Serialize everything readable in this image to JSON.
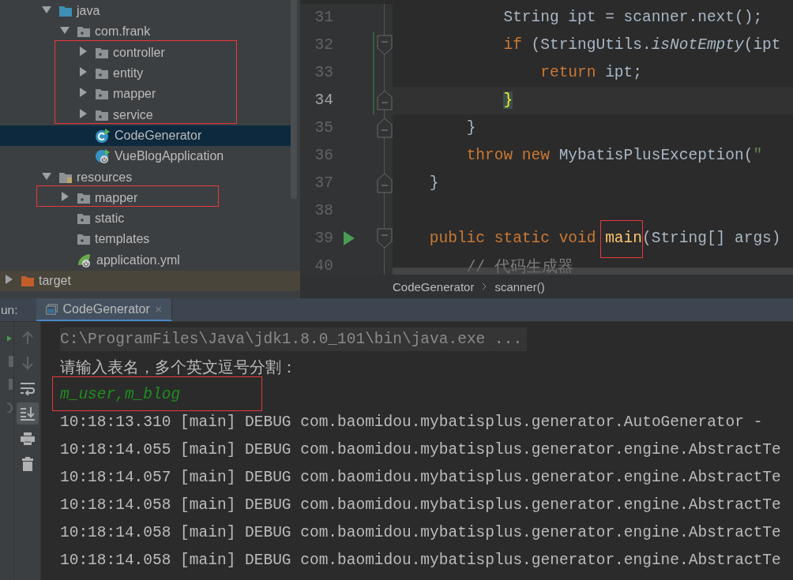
{
  "project_tree": {
    "items": [
      {
        "label": "java",
        "kind": "source-folder",
        "expanded": true,
        "selected": false,
        "boxed": false,
        "children": [
          {
            "label": "com.frank",
            "kind": "package",
            "expanded": true,
            "selected": false,
            "boxed": false,
            "children": [
              {
                "label": "controller",
                "kind": "package",
                "expanded": false,
                "selected": false,
                "boxed": true
              },
              {
                "label": "entity",
                "kind": "package",
                "expanded": false,
                "selected": false,
                "boxed": true
              },
              {
                "label": "mapper",
                "kind": "package",
                "expanded": false,
                "selected": false,
                "boxed": true
              },
              {
                "label": "service",
                "kind": "package",
                "expanded": false,
                "selected": false,
                "boxed": true
              },
              {
                "label": "CodeGenerator",
                "kind": "runnable-class",
                "selected": true,
                "boxed": false
              },
              {
                "label": "VueBlogApplication",
                "kind": "spring-app",
                "selected": false,
                "boxed": false
              }
            ]
          }
        ]
      },
      {
        "label": "resources",
        "kind": "resources-folder",
        "expanded": true,
        "selected": false,
        "boxed": false,
        "children": [
          {
            "label": "mapper",
            "kind": "package",
            "expanded": false,
            "selected": false,
            "boxed": true
          },
          {
            "label": "static",
            "kind": "package",
            "selected": false,
            "boxed": false
          },
          {
            "label": "templates",
            "kind": "package",
            "selected": false,
            "boxed": false
          },
          {
            "label": "application.yml",
            "kind": "spring-config",
            "selected": false,
            "boxed": false
          }
        ]
      }
    ],
    "root_items": [
      {
        "label": "target",
        "kind": "excluded-folder",
        "expanded": false,
        "selected": false,
        "boxed": false
      }
    ]
  },
  "editor": {
    "lines": [
      {
        "number": "31",
        "current": false,
        "changed": false,
        "run": false,
        "fold_open": false,
        "fold_close": false,
        "tokens": [
          {
            "kind": "plain",
            "text": "            String ipt = scanner.next();"
          }
        ]
      },
      {
        "number": "32",
        "current": false,
        "changed": true,
        "run": false,
        "fold_open": true,
        "fold_close": false,
        "tokens": [
          {
            "kind": "keyword",
            "text": "            if"
          },
          {
            "kind": "plain",
            "text": " (StringUtils."
          },
          {
            "kind": "static-call",
            "text": "isNotEmpty"
          },
          {
            "kind": "plain",
            "text": "(ipt"
          }
        ]
      },
      {
        "number": "33",
        "current": false,
        "changed": true,
        "run": false,
        "fold_open": false,
        "fold_close": false,
        "tokens": [
          {
            "kind": "keyword",
            "text": "                return"
          },
          {
            "kind": "plain",
            "text": " ipt;"
          }
        ]
      },
      {
        "number": "34",
        "current": true,
        "changed": true,
        "run": false,
        "fold_open": false,
        "fold_close": true,
        "tokens": [
          {
            "kind": "matched-brace",
            "text": "            }"
          }
        ]
      },
      {
        "number": "35",
        "current": false,
        "changed": false,
        "run": false,
        "fold_open": false,
        "fold_close": true,
        "tokens": [
          {
            "kind": "plain",
            "text": "        }"
          }
        ]
      },
      {
        "number": "36",
        "current": false,
        "changed": false,
        "run": false,
        "fold_open": false,
        "fold_close": false,
        "tokens": [
          {
            "kind": "keyword",
            "text": "        throw"
          },
          {
            "kind": "keyword",
            "text": " new"
          },
          {
            "kind": "plain",
            "text": " MybatisPlusException("
          },
          {
            "kind": "string",
            "text": "\""
          }
        ]
      },
      {
        "number": "37",
        "current": false,
        "changed": false,
        "run": false,
        "fold_open": false,
        "fold_close": true,
        "tokens": [
          {
            "kind": "plain",
            "text": "    }"
          }
        ]
      },
      {
        "number": "38",
        "current": false,
        "changed": false,
        "run": false,
        "fold_open": false,
        "fold_close": false
      },
      {
        "number": "39",
        "current": false,
        "changed": false,
        "run": true,
        "fold_open": true,
        "fold_close": false,
        "tokens": [
          {
            "kind": "keyword",
            "text": "    public"
          },
          {
            "kind": "keyword",
            "text": " static"
          },
          {
            "kind": "keyword",
            "text": " void"
          },
          {
            "kind": "method",
            "text": " main",
            "boxed": true
          },
          {
            "kind": "plain",
            "text": "(String[] args)"
          }
        ]
      },
      {
        "number": "40",
        "current": false,
        "changed": false,
        "run": false,
        "fold_open": false,
        "fold_close": false,
        "tokens": [
          {
            "kind": "comment",
            "text": "        // 代码生成器"
          }
        ]
      }
    ],
    "breadcrumb": [
      "CodeGenerator",
      "scanner()"
    ]
  },
  "run_panel": {
    "label": "un:",
    "tabs": [
      {
        "label": "CodeGenerator",
        "selected": true,
        "closable": true
      }
    ],
    "tools": [
      {
        "kind": "up",
        "on": false,
        "disabled": true
      },
      {
        "kind": "down",
        "on": false,
        "disabled": true
      },
      {
        "kind": "soft-wrap",
        "on": false,
        "disabled": false
      },
      {
        "kind": "scroll-to-end",
        "on": true,
        "disabled": false
      },
      {
        "kind": "print",
        "on": false,
        "disabled": false
      },
      {
        "kind": "clear",
        "on": false,
        "disabled": false
      }
    ],
    "console": [
      {
        "kind": "command",
        "text": "C:\\ProgramFiles\\Java\\jdk1.8.0_101\\bin\\java.exe ..."
      },
      {
        "kind": "prompt",
        "text": "请输入表名，多个英文逗号分割："
      },
      {
        "kind": "input",
        "text": "m_user,m_blog",
        "boxed": true
      },
      {
        "kind": "log",
        "text": "10:18:13.310 [main] DEBUG com.baomidou.mybatisplus.generator.AutoGenerator -"
      },
      {
        "kind": "log",
        "text": "10:18:14.055 [main] DEBUG com.baomidou.mybatisplus.generator.engine.AbstractTe"
      },
      {
        "kind": "log",
        "text": "10:18:14.057 [main] DEBUG com.baomidou.mybatisplus.generator.engine.AbstractTe"
      },
      {
        "kind": "log",
        "text": "10:18:14.058 [main] DEBUG com.baomidou.mybatisplus.generator.engine.AbstractTe"
      },
      {
        "kind": "log",
        "text": "10:18:14.058 [main] DEBUG com.baomidou.mybatisplus.generator.engine.AbstractTe"
      },
      {
        "kind": "log",
        "text": "10:18:14.058 [main] DEBUG com.baomidou.mybatisplus.generator.engine.AbstractTe"
      }
    ]
  }
}
